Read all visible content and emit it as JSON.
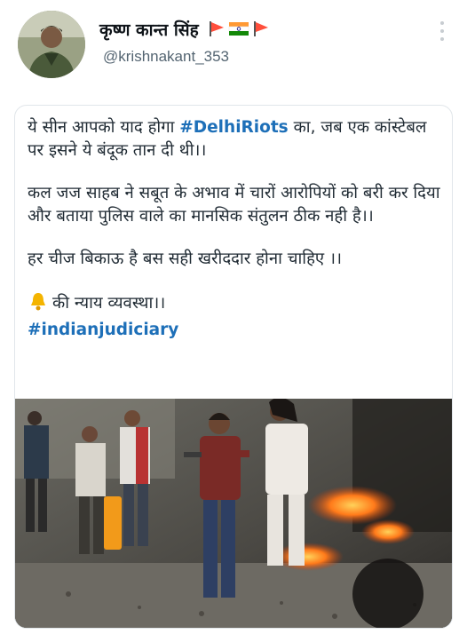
{
  "profile": {
    "display_name": "कृष्ण कान्त सिंह",
    "handle": "@krishnakant_353",
    "flag_icons": [
      "flag-icon",
      "india-flag-icon",
      "flag-icon"
    ]
  },
  "tweet": {
    "para1_pre": "ये सीन आपको याद होगा ",
    "para1_hashtag": "#DelhiRiots",
    "para1_post": " का, जब एक कांस्टेबल पर इसने ये बंदूक तान दी थी।।",
    "para2": "कल जज साहब ने सबूत के अभाव में चारों आरोपियों को बरी कर दिया और बताया पुलिस वाले का मानसिक संतुलन ठीक नही है।।",
    "para3": "हर चीज बिकाऊ है बस सही खरीददार होना चाहिए ।।",
    "para4_text": "की न्याय व्यवस्था।।",
    "para4_hashtag": "#indianjudiciary"
  },
  "colors": {
    "hashtag": "#1d6fb8",
    "flag_saffron": "#ff4f3c",
    "india_orange": "#ff9933",
    "india_green": "#138808"
  }
}
